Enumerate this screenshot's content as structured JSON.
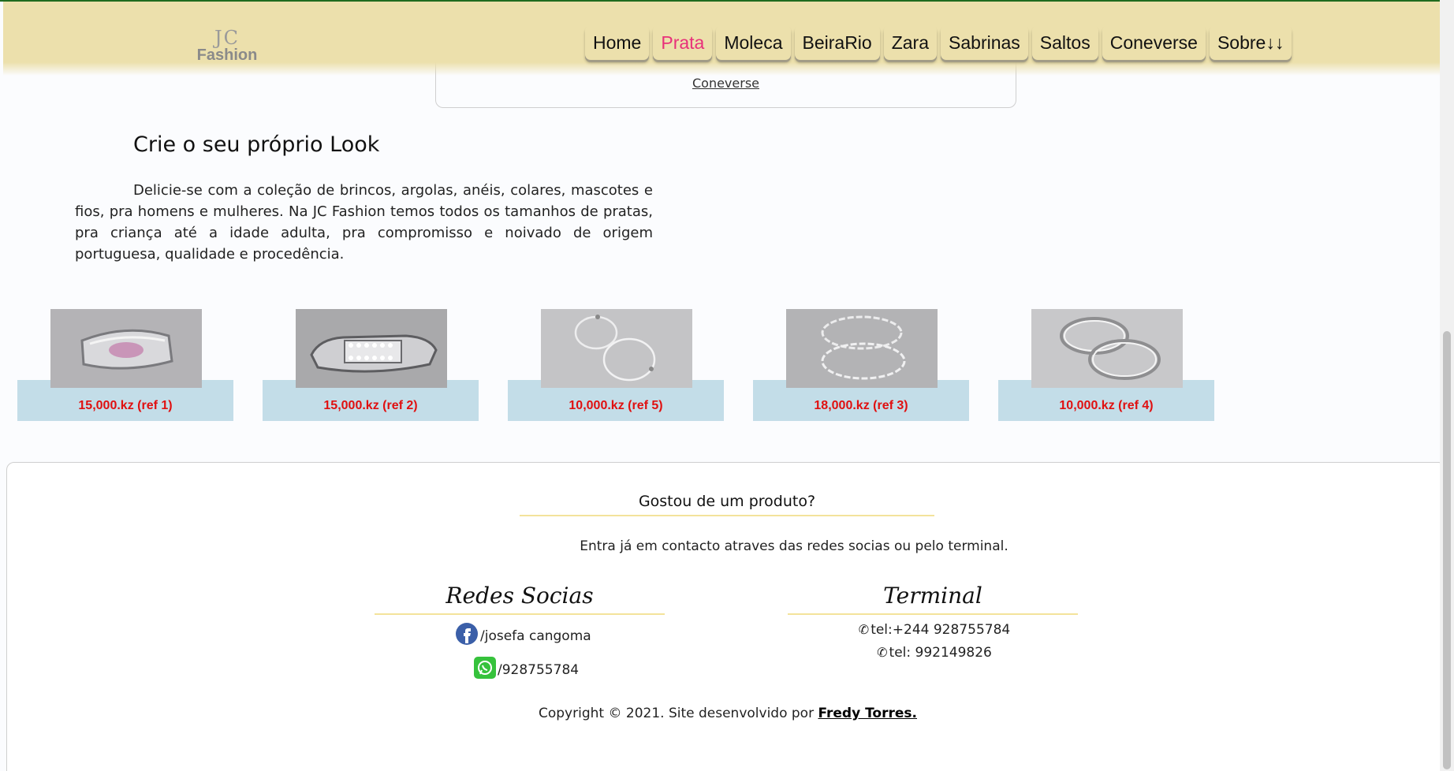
{
  "header": {
    "logo_mark": "JC",
    "logo_text": "Fashion",
    "nav": [
      "Home",
      "Prata",
      "Moleca",
      "BeiraRio",
      "Zara",
      "Sabrinas",
      "Saltos",
      "Coneverse",
      "Sobre↓↓"
    ],
    "active_nav": "Prata"
  },
  "previous_card": {
    "link": "Coneverse"
  },
  "intro": {
    "title": "Crie o seu próprio Look",
    "text": "Delicie-se com a coleção de brincos, argolas, anéis, colares, mascotes e fios, pra homens e mulheres. Na JC Fashion temos todos os tamanhos de pratas, pra criança até a idade adulta, pra compromisso e noivado de origem portuguesa, qualidade e procedência."
  },
  "products": [
    {
      "price": "15,000.kz (ref 1)",
      "image": "silver ring with pink stone"
    },
    {
      "price": "15,000.kz (ref 2)",
      "image": "silver ring with crystals"
    },
    {
      "price": "10,000.kz (ref 5)",
      "image": "silver hoop earrings"
    },
    {
      "price": "18,000.kz (ref 3)",
      "image": "twisted silver hoops"
    },
    {
      "price": "10,000.kz (ref 4)",
      "image": "silver hoop rings"
    }
  ],
  "footer": {
    "title": "Gostou de um produto?",
    "subtitle": "Entra já em contacto atraves das redes socias ou pelo terminal.",
    "social_title": "Redes Socias",
    "facebook": "/josefa cangoma",
    "whatsapp": "/928755784",
    "terminal_title": "Terminal",
    "phone1": "tel:+244 928755784",
    "phone2": "tel: 992149826",
    "copyright": "Copyright © 2021. Site desenvolvido por",
    "author": "Fredy Torres."
  },
  "colors": {
    "header_bg": "#ece0ac",
    "active_nav": "#e8317a",
    "price": "#e01010",
    "price_band": "#c3dde8",
    "underline": "#f3e39b"
  }
}
